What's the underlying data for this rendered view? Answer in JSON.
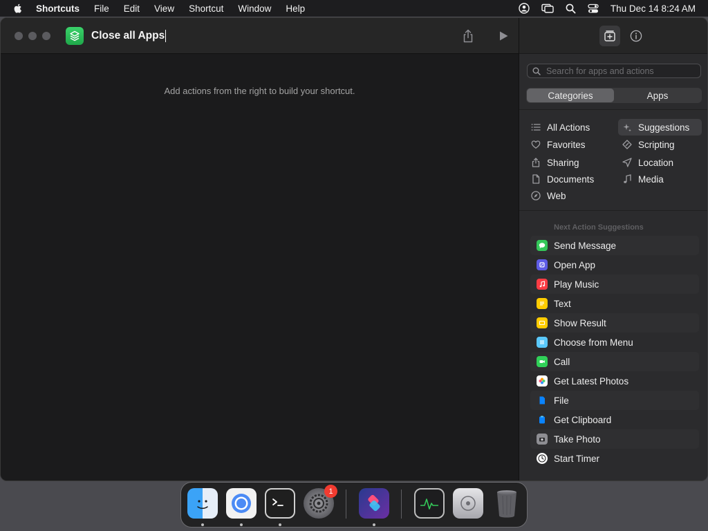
{
  "menubar": {
    "app_name": "Shortcuts",
    "items": [
      "File",
      "Edit",
      "View",
      "Shortcut",
      "Window",
      "Help"
    ],
    "clock": "Thu Dec 14  8:24 AM"
  },
  "editor": {
    "title": "Close all Apps",
    "hint": "Add actions from the right to build your shortcut."
  },
  "sidebar": {
    "search_placeholder": "Search for apps and actions",
    "segments": [
      "Categories",
      "Apps"
    ],
    "categories_left": [
      "All Actions",
      "Favorites",
      "Sharing",
      "Documents",
      "Web"
    ],
    "categories_right": [
      "Suggestions",
      "Scripting",
      "Location",
      "Media"
    ],
    "suggestions_header": "Next Action Suggestions",
    "suggestions": [
      {
        "label": "Send Message",
        "icon": "messages-icon",
        "color": "#34c759"
      },
      {
        "label": "Open App",
        "icon": "open-app-icon",
        "color": "#5e5ce6"
      },
      {
        "label": "Play Music",
        "icon": "music-icon",
        "color": "#fc3c44"
      },
      {
        "label": "Text",
        "icon": "text-icon",
        "color": "#ffcc00"
      },
      {
        "label": "Show Result",
        "icon": "show-result-icon",
        "color": "#ffcc00"
      },
      {
        "label": "Choose from Menu",
        "icon": "menu-icon",
        "color": "#5ac8fa"
      },
      {
        "label": "Call",
        "icon": "phone-icon",
        "color": "#30d158"
      },
      {
        "label": "Get Latest Photos",
        "icon": "photos-icon",
        "color": "#ffffff"
      },
      {
        "label": "File",
        "icon": "file-icon",
        "color": "#0a84ff"
      },
      {
        "label": "Get Clipboard",
        "icon": "clipboard-icon",
        "color": "#0a84ff"
      },
      {
        "label": "Take Photo",
        "icon": "camera-icon",
        "color": "#8e8e93"
      },
      {
        "label": "Start Timer",
        "icon": "clock-icon",
        "color": "#ffffff"
      }
    ]
  },
  "dock": {
    "apps": [
      "Finder",
      "Chromium",
      "Terminal",
      "System Settings",
      "Shortcuts",
      "Activity Monitor",
      "Disk Utility",
      "Trash"
    ],
    "settings_badge": "1"
  },
  "colors": {
    "accent_green": "#2bbf57",
    "window_bg": "#1b1b1c",
    "sidebar_bg": "#2b2b2d"
  }
}
